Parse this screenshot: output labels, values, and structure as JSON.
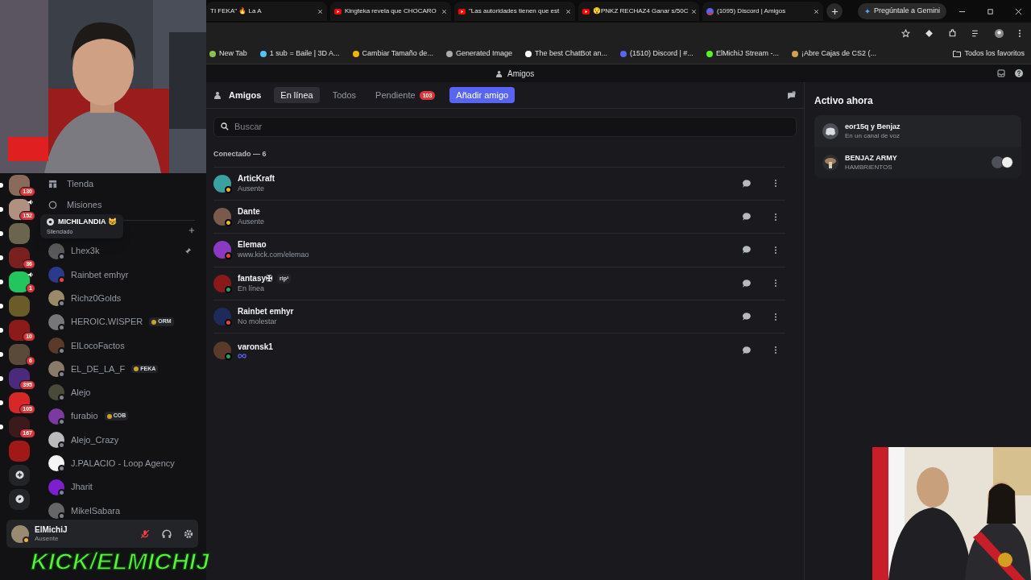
{
  "browser": {
    "tabs": [
      {
        "title": "TI FEKA\" 🔥 La A"
      },
      {
        "title": "Kingteka revela que CHOCARO"
      },
      {
        "title": "\"Las autoridades tienen que est"
      },
      {
        "title": "😯PNKZ RECHAZ4 Ganar s/50C"
      },
      {
        "title": "(1095) Discord | Amigos"
      }
    ],
    "gemini_button": "Pregúntale a Gemini",
    "bookmarks": [
      "New Tab",
      "1 sub = Baile | 3D A...",
      "Cambiar Tamaño de...",
      "Generated Image",
      "The best ChatBot an...",
      "(1510) Discord | #...",
      "ElMichiJ Stream -...",
      "¡Abre Cajas de CS2 (..."
    ],
    "all_bookmarks": "Todos los favoritos"
  },
  "discord": {
    "window_title": "Amigos",
    "servers": [
      {
        "kind": "server",
        "badge": "130",
        "voice": false,
        "unread": true,
        "color": "#8a6a5a"
      },
      {
        "kind": "server",
        "badge": "152",
        "voice": true,
        "unread": true,
        "color": "#b09080"
      },
      {
        "kind": "server",
        "voice": false,
        "unread": true,
        "color": "#6b6550"
      },
      {
        "kind": "server",
        "badge": "36",
        "voice": false,
        "unread": true,
        "color": "#7a2020"
      },
      {
        "kind": "server",
        "badge": "1",
        "voice": true,
        "unread": true,
        "color": "#22c55e"
      },
      {
        "kind": "server",
        "voice": false,
        "unread": true,
        "color": "#6b5a2a"
      },
      {
        "kind": "server",
        "badge": "10",
        "voice": false,
        "unread": true,
        "color": "#8b1a1a"
      },
      {
        "kind": "server",
        "badge": "6",
        "voice": false,
        "unread": true,
        "color": "#5a4a3a"
      },
      {
        "kind": "server",
        "badge": "395",
        "voice": false,
        "unread": true,
        "color": "#4a2a7a"
      },
      {
        "kind": "server",
        "badge": "105",
        "voice": false,
        "unread": true,
        "color": "#d62828"
      },
      {
        "kind": "server",
        "badge": "167",
        "voice": false,
        "unread": true,
        "color": "#3a1a1a"
      },
      {
        "kind": "server",
        "voice": false,
        "unread": false,
        "color": "#a01818"
      },
      {
        "kind": "add"
      },
      {
        "kind": "discover"
      }
    ],
    "tooltip": {
      "title": "MICHILANDIA 😺",
      "subtitle": "Silenciado"
    },
    "nav": [
      "Tienda",
      "Misiones"
    ],
    "dms": [
      {
        "name": "Lhex3k",
        "color": "#80848e",
        "pinned": true
      },
      {
        "name": "Rainbet emhyr",
        "color": "#f23f43",
        "pinned": false
      },
      {
        "name": "Richz0Golds",
        "color": "#80848e",
        "pinned": false
      },
      {
        "name": "HEROIC.WISPER",
        "color": "#80848e",
        "pinned": false,
        "tag": "ORM"
      },
      {
        "name": "ElLocoFactos",
        "color": "#80848e",
        "pinned": false
      },
      {
        "name": "EL_DE_LA_F",
        "color": "#80848e",
        "pinned": false,
        "tag": "FEKA"
      },
      {
        "name": "Alejo",
        "color": "#80848e",
        "pinned": false
      },
      {
        "name": "furabio",
        "color": "#80848e",
        "pinned": false,
        "tag": "COB"
      },
      {
        "name": "Alejo_Crazy",
        "color": "#80848e",
        "pinned": false
      },
      {
        "name": "J.PALACIO - Loop Agency",
        "color": "#80848e",
        "pinned": false
      },
      {
        "name": "Jharit",
        "color": "#80848e",
        "pinned": false
      },
      {
        "name": "MikelSabara",
        "color": "#80848e",
        "pinned": false
      }
    ],
    "user": {
      "name": "ElMichiJ",
      "status_text": "Ausente",
      "color": "#f0b232",
      "muted": true
    },
    "header": {
      "title": "Amigos",
      "tabs": [
        {
          "label": "En línea",
          "selected": true
        },
        {
          "label": "Todos",
          "selected": false
        },
        {
          "label": "Pendiente",
          "selected": false,
          "badge": "103"
        }
      ],
      "add_button": "Añadir amigo"
    },
    "search": {
      "placeholder": "Buscar"
    },
    "section_title": "Conectado — 6",
    "friends": [
      {
        "name": "ArticKraft",
        "color": "#f0b232",
        "status_text": "Ausente"
      },
      {
        "name": "Dante",
        "color": "#f0b232",
        "status_text": "Ausente"
      },
      {
        "name": "Elemao",
        "color": "#f23f43",
        "status_text": "www.kick.com/elemao"
      },
      {
        "name": "fantasy✠",
        "color": "#23a55a",
        "status_text": "En línea",
        "tag": "rip²"
      },
      {
        "name": "Rainbet emhyr",
        "color": "#f23f43",
        "status_text": "No molestar"
      },
      {
        "name": "varonsk1",
        "color": "#23a55a"
      }
    ],
    "active_now": {
      "title": "Activo ahora",
      "items": [
        {
          "title": "eor15q y Benjaz",
          "subtitle": "En un canal de voz"
        },
        {
          "title": "BENJAZ ARMY",
          "subtitle": "HAMBRIENTOS"
        }
      ]
    }
  },
  "overlay_text": "KICK/ELMICHIJ"
}
